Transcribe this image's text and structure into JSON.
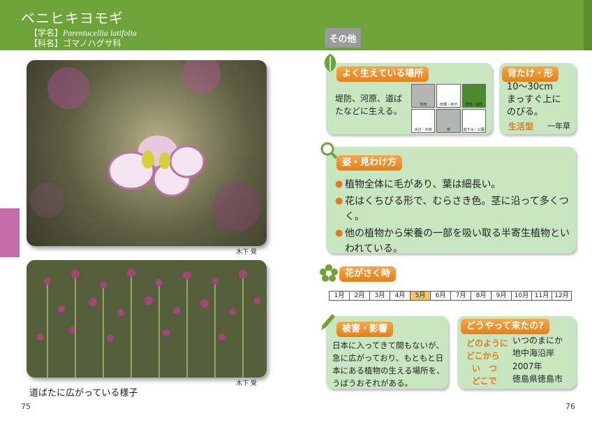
{
  "header": {
    "species_name": "ベニヒキヨモギ",
    "scientific_prefix": "【学名】",
    "scientific_name": "Parentucellia latifolia",
    "family_line": "【科名】ゴマノハグサ科",
    "other_tab": "その他"
  },
  "photos": {
    "credit_1": "木下 覺",
    "credit_2": "木下 覺",
    "caption": "道ばたに広がっている様子"
  },
  "pages": {
    "left": "75",
    "right": "76"
  },
  "habitat": {
    "title": "よく生えている場所",
    "text_line1": "堤防、河原、道ば",
    "text_line2": "たなどに生える。",
    "icons": [
      {
        "label": "冬田",
        "style": "gray"
      },
      {
        "label": "田畑・あぜ",
        "style": "light"
      },
      {
        "label": "草地・堤防",
        "style": "dark"
      },
      {
        "label": "水辺・水田",
        "style": "light"
      },
      {
        "label": "林",
        "style": "gray"
      },
      {
        "label": "庭すみ・公園",
        "style": "light"
      }
    ]
  },
  "height": {
    "title": "背たけ・形",
    "line1": "10〜30cm",
    "line2": "まっすぐ上に",
    "line3": "のびる。",
    "life_label": "生活型",
    "life_value": "一年草"
  },
  "features": {
    "title": "姿・見わけ方",
    "items": [
      "植物全体に毛があり、葉は細長い。",
      "花はくちびる形で、むらさき色。茎に沿って多くつく。",
      "他の植物から栄養の一部を吸い取る半寄生植物といわれている。"
    ]
  },
  "bloom": {
    "title": "花がさく時",
    "months": [
      "1月",
      "2月",
      "3月",
      "4月",
      "5月",
      "6月",
      "7月",
      "8月",
      "9月",
      "10月",
      "11月",
      "12月"
    ],
    "active_months": [
      5
    ]
  },
  "damage": {
    "title": "被害・影響",
    "lines": [
      "日本に入ってきて間もないが、",
      "急に広がっており、もともと日",
      "本にある植物の生える場所を、",
      "うばうおそれがある。"
    ]
  },
  "origin": {
    "title": "どうやって来たの?",
    "q_how": "どのように",
    "q_from": "どこから",
    "q_when": "い　つ",
    "q_where": "どこで",
    "a_how": "いつのまにか",
    "a_from": "地中海沿岸",
    "a_when": "2007年",
    "a_where": "徳島県徳島市"
  },
  "colors": {
    "header_green": "#6ea33a",
    "card_green": "#c8e6bf",
    "accent_orange": "#e6781e",
    "side_tab_pink": "#c76aa8"
  }
}
